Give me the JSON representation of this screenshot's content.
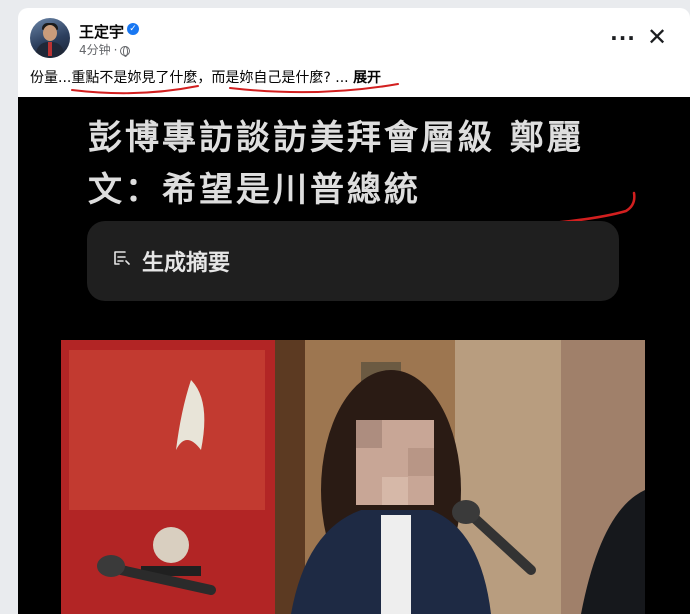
{
  "post": {
    "author": "王定宇",
    "time": "4分钟",
    "separator": "·",
    "text_a": "份量...",
    "text_b": "重點不是妳見了什麼",
    "text_c": "，",
    "text_d": "而是妳自己是什麼?",
    "text_e": " ... ",
    "expand": "展开"
  },
  "media": {
    "headline_line1": "彭博專訪談訪美拜會層級 鄭麗",
    "headline_line2": "文：希望是川普總統",
    "summary_label": "生成摘要"
  },
  "colors": {
    "accent": "#1877f2",
    "ink": "#d21f1f",
    "media_bg": "#000000"
  },
  "icons": [
    "verified-badge-icon",
    "globe-icon",
    "more-icon",
    "close-icon",
    "summary-icon"
  ]
}
